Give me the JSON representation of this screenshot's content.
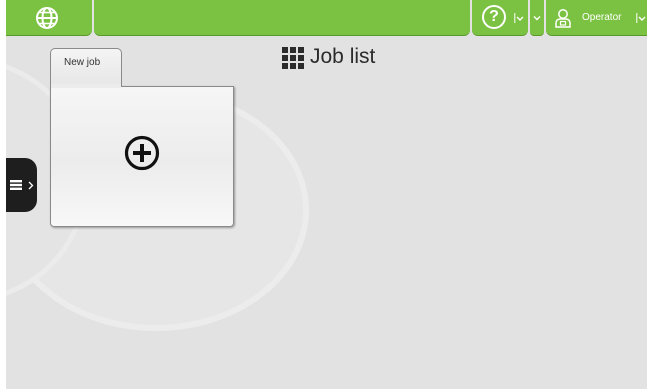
{
  "header": {
    "globe_icon": "globe-icon",
    "help_icon": "help-icon",
    "help_glyph": "?",
    "user_icon": "operator-icon",
    "user_label": "Operator",
    "accent_color": "#7cc242"
  },
  "main": {
    "title": "Job list",
    "title_icon": "grid-icon"
  },
  "jobs": {
    "new_job_label": "New job",
    "new_job_icon": "plus-circle-icon"
  },
  "side_panel": {
    "handle_icon": "list-icon",
    "expand_icon": "chevron-right-icon"
  }
}
